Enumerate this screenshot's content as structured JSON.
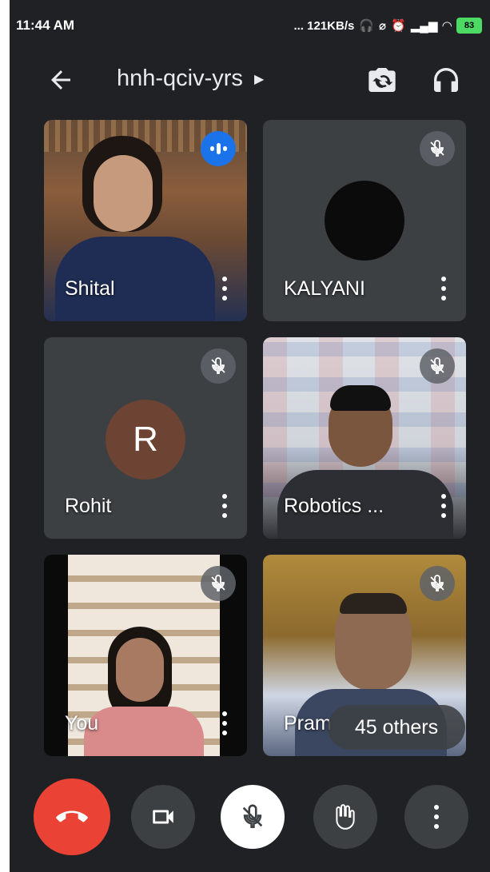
{
  "status_bar": {
    "time": "11:44 AM",
    "speed": "... 121KB/s",
    "battery": "83"
  },
  "header": {
    "meeting_code": "hnh-qciv-yrs"
  },
  "participants": [
    {
      "name": "Shital",
      "state": "speaking"
    },
    {
      "name": "KALYANI",
      "state": "muted"
    },
    {
      "name": "Rohit",
      "avatar_letter": "R",
      "state": "muted"
    },
    {
      "name": "Robotics ...",
      "state": "muted"
    },
    {
      "name": "You",
      "state": "muted"
    },
    {
      "name": "Pram",
      "state": "muted"
    }
  ],
  "others_pill": "45 others",
  "colors": {
    "background": "#202124",
    "tile": "#3c4043",
    "end_call": "#ea4335",
    "speaking": "#1a73e8",
    "avatar_rohit": "#6d4334"
  },
  "icons": [
    "back-arrow-icon",
    "switch-camera-icon",
    "headphones-icon",
    "mic-off-icon",
    "end-call-icon",
    "camera-icon",
    "raise-hand-icon",
    "more-options-icon"
  ]
}
